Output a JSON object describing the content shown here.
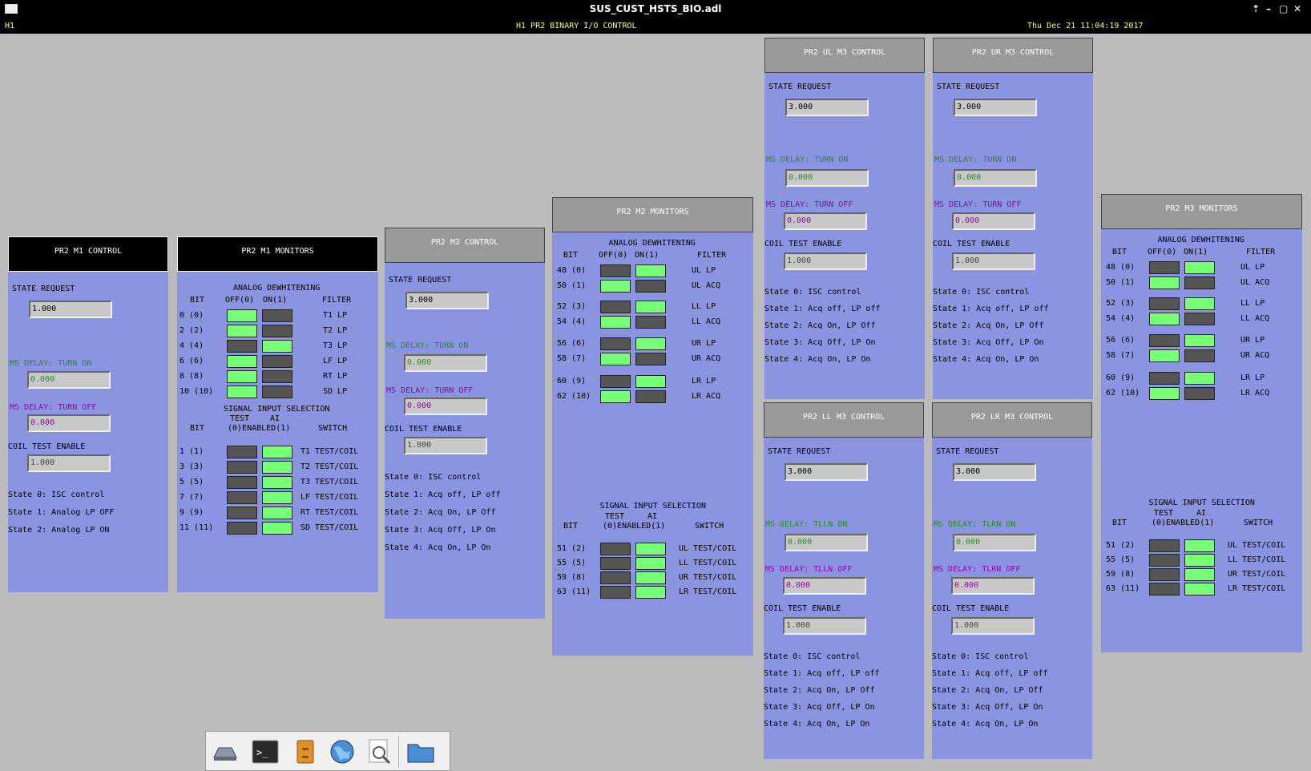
{
  "window": {
    "title": "SUS_CUST_HSTS_BIO.adl",
    "controls": [
      "⇡",
      "–",
      "▢",
      "✕"
    ]
  },
  "header": {
    "site": "H1",
    "title": "H1 PR2 BINARY I/O CONTROL",
    "datetime": "Thu Dec 21 11:04:19 2017"
  },
  "common": {
    "state_request": "STATE REQUEST",
    "ms_on": "MS DELAY: TURN ON",
    "ms_off": "MS DELAY: TURN OFF",
    "coil": "COIL TEST ENABLE",
    "analog": "ANALOG DEWHITENING",
    "sig": "SIGNAL INPUT SELECTION",
    "bit": "BIT",
    "off0": "OFF(0)",
    "on1": "ON(1)",
    "filter": "FILTER",
    "test": "TEST",
    "ai": "AI",
    "enabled": "(0)ENABLED(1)",
    "switch": "SWITCH"
  },
  "m1ctl": {
    "title": "PR2 M1 CONTROL",
    "state": "1.000",
    "on": "0.000",
    "off": "0.000",
    "coil": "1.000",
    "states": [
      "State 0: ISC control",
      "State 1: Analog LP OFF",
      "State 2: Analog LP ON"
    ]
  },
  "m1mon": {
    "title": "PR2 M1 MONITORS",
    "adw": [
      {
        "bit": "0 (0)",
        "f": "T1 LP",
        "on": false
      },
      {
        "bit": "2 (2)",
        "f": "T2 LP",
        "on": false
      },
      {
        "bit": "4 (4)",
        "f": "T3 LP",
        "on": true
      },
      {
        "bit": "6 (6)",
        "f": "LF LP",
        "on": false
      },
      {
        "bit": "8 (8)",
        "f": "RT LP",
        "on": false
      },
      {
        "bit": "10 (10)",
        "f": "SD LP",
        "on": false
      }
    ],
    "sig": [
      {
        "bit": "1 (1)",
        "f": "T1 TEST/COIL"
      },
      {
        "bit": "3 (3)",
        "f": "T2 TEST/COIL"
      },
      {
        "bit": "5 (5)",
        "f": "T3 TEST/COIL"
      },
      {
        "bit": "7 (7)",
        "f": "LF TEST/COIL"
      },
      {
        "bit": "9 (9)",
        "f": "RT TEST/COIL"
      },
      {
        "bit": "11 (11)",
        "f": "SD TEST/COIL"
      }
    ]
  },
  "m2ctl": {
    "title": "PR2 M2 CONTROL",
    "state": "3.000",
    "on": "0.000",
    "off": "0.000",
    "coil": "1.000",
    "states": [
      "State 0: ISC control",
      "State 1: Acq off, LP off",
      "State 2: Acq On, LP Off",
      "State 3: Acq Off, LP On",
      "State 4: Acq On, LP On"
    ]
  },
  "m2mon": {
    "title": "PR2 M2 MONITORS",
    "adw": [
      {
        "bit": "48 (0)",
        "f": "UL LP",
        "on": true
      },
      {
        "bit": "50 (1)",
        "f": "UL ACQ",
        "on": false
      },
      {
        "bit": "52 (3)",
        "f": "LL LP",
        "on": true
      },
      {
        "bit": "54 (4)",
        "f": "LL ACQ",
        "on": false
      },
      {
        "bit": "56 (6)",
        "f": "UR LP",
        "on": true
      },
      {
        "bit": "58 (7)",
        "f": "UR ACQ",
        "on": false
      },
      {
        "bit": "60 (9)",
        "f": "LR LP",
        "on": true
      },
      {
        "bit": "62 (10)",
        "f": "LR ACQ",
        "on": false
      }
    ],
    "sig": [
      {
        "bit": "51 (2)",
        "f": "UL TEST/COIL"
      },
      {
        "bit": "55 (5)",
        "f": "LL TEST/COIL"
      },
      {
        "bit": "59 (8)",
        "f": "UR TEST/COIL"
      },
      {
        "bit": "63 (11)",
        "f": "LR TEST/COIL"
      }
    ]
  },
  "m3": [
    {
      "title": "PR2 UL M3 CONTROL",
      "state": "3.000",
      "on": "0.000",
      "off": "0.000",
      "coil": "1.000",
      "on_label": "MS DELAY: TURN ON",
      "off_label": "MS DELAY: TURN OFF"
    },
    {
      "title": "PR2 UR M3 CONTROL",
      "state": "3.000",
      "on": "0.000",
      "off": "0.000",
      "coil": "1.000",
      "on_label": "MS DELAY: TURN ON",
      "off_label": "MS DELAY: TURN OFF"
    },
    {
      "title": "PR2 LL M3 CONTROL",
      "state": "3.000",
      "on": "0.000",
      "off": "0.000",
      "coil": "1.000",
      "on_label": "MS DELAY: TLLN ON",
      "off_label": "MS DELAY: TLLN OFF"
    },
    {
      "title": "PR2 LR M3 CONTROL",
      "state": "3.000",
      "on": "0.000",
      "off": "0.000",
      "coil": "1.000",
      "on_label": "MS DELAY: TLRN ON",
      "off_label": "MS DELAY: TLRN OFF"
    }
  ],
  "m3states": [
    "State 0: ISC control",
    "State 1: Acq off, LP off",
    "State 2: Acq On, LP Off",
    "State 3: Acq Off, LP On",
    "State 4: Acq On, LP On"
  ],
  "m3mon": {
    "title": "PR2 M3 MONITORS",
    "adw": [
      {
        "bit": "48 (0)",
        "f": "UL LP",
        "on": true
      },
      {
        "bit": "50 (1)",
        "f": "UL ACQ",
        "on": false
      },
      {
        "bit": "52 (3)",
        "f": "LL LP",
        "on": true
      },
      {
        "bit": "54 (4)",
        "f": "LL ACQ",
        "on": false
      },
      {
        "bit": "56 (6)",
        "f": "UR LP",
        "on": true
      },
      {
        "bit": "58 (7)",
        "f": "UR ACQ",
        "on": false
      },
      {
        "bit": "60 (9)",
        "f": "LR LP",
        "on": true
      },
      {
        "bit": "62 (10)",
        "f": "LR ACQ",
        "on": false
      }
    ],
    "sig": [
      {
        "bit": "51 (2)",
        "f": "UL TEST/COIL"
      },
      {
        "bit": "55 (5)",
        "f": "LL TEST/COIL"
      },
      {
        "bit": "59 (8)",
        "f": "UR TEST/COIL"
      },
      {
        "bit": "63 (11)",
        "f": "LR TEST/COIL"
      }
    ]
  },
  "taskbar": [
    {
      "icon": "drive-icon"
    },
    {
      "icon": "terminal-icon",
      "glyph": ">_"
    },
    {
      "icon": "files-icon"
    },
    {
      "icon": "globe-icon"
    },
    {
      "icon": "search-icon"
    },
    {
      "icon": "folder-icon"
    }
  ]
}
